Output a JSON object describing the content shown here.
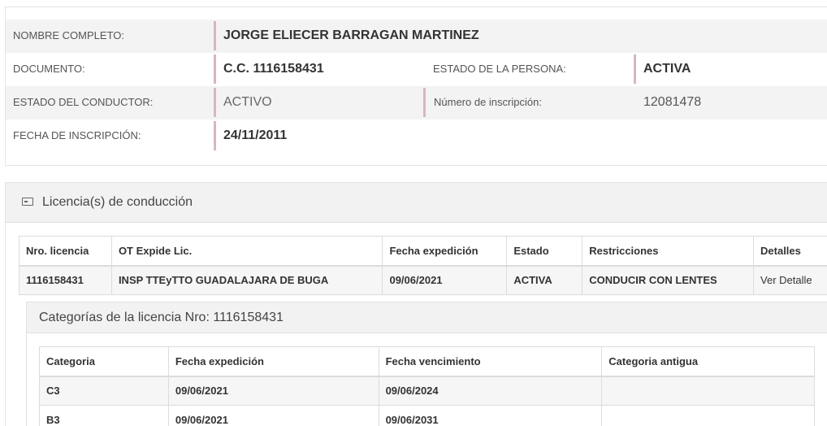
{
  "person": {
    "full_name_label": "NOMBRE COMPLETO:",
    "full_name": "JORGE ELIECER BARRAGAN MARTINEZ",
    "document_label": "DOCUMENTO:",
    "document": "C.C. 1116158431",
    "person_state_label": "ESTADO DE LA PERSONA:",
    "person_state": "ACTIVA",
    "driver_state_label": "ESTADO DEL CONDUCTOR:",
    "driver_state": "ACTIVO",
    "registration_number_label": "Número de inscripción:",
    "registration_number": "12081478",
    "registration_date_label": "FECHA DE INSCRIPCIÓN:",
    "registration_date": "24/11/2011"
  },
  "licenses": {
    "title": "Licencia(s) de conducción",
    "icon": "id-card-icon",
    "columns": [
      "Nro. licencia",
      "OT Expide Lic.",
      "Fecha expedición",
      "Estado",
      "Restricciones",
      "Detalles"
    ],
    "rows": [
      {
        "number": "1116158431",
        "issuer": "INSP TTEyTTO GUADALAJARA DE BUGA",
        "issue_date": "09/06/2021",
        "state": "ACTIVA",
        "restrictions": "CONDUCIR CON LENTES",
        "details": "Ver Detalle"
      }
    ]
  },
  "categories": {
    "title": "Categorías de la licencia Nro: 1116158431",
    "columns": [
      "Categoria",
      "Fecha expedición",
      "Fecha vencimiento",
      "Categoria antigua"
    ],
    "rows": [
      {
        "category": "C3",
        "issue_date": "09/06/2021",
        "expiry_date": "09/06/2024",
        "old_category": ""
      },
      {
        "category": "B3",
        "issue_date": "09/06/2021",
        "expiry_date": "09/06/2031",
        "old_category": ""
      }
    ]
  },
  "colors": {
    "accent_border": "#d7b6bf",
    "row_shade": "#f3f3f3"
  }
}
